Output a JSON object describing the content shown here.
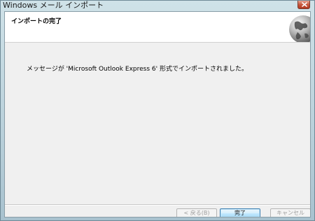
{
  "window": {
    "title": "Windows メール インポート"
  },
  "header": {
    "title": "インポートの完了"
  },
  "main": {
    "message": "メッセージが 'Microsoft Outlook Express 6' 形式でインポートされました。"
  },
  "buttons": {
    "back_label": "< 戻る(B)",
    "finish_label": "完了",
    "cancel_label": "キャンセル"
  },
  "icons": {
    "close": "close-icon",
    "wizard": "globe-icon"
  },
  "colors": {
    "title_bar": "#b9d0da",
    "close_button": "#c75a40",
    "default_button_border": "#3c7fb1",
    "disabled_text": "#9d9d9d"
  }
}
